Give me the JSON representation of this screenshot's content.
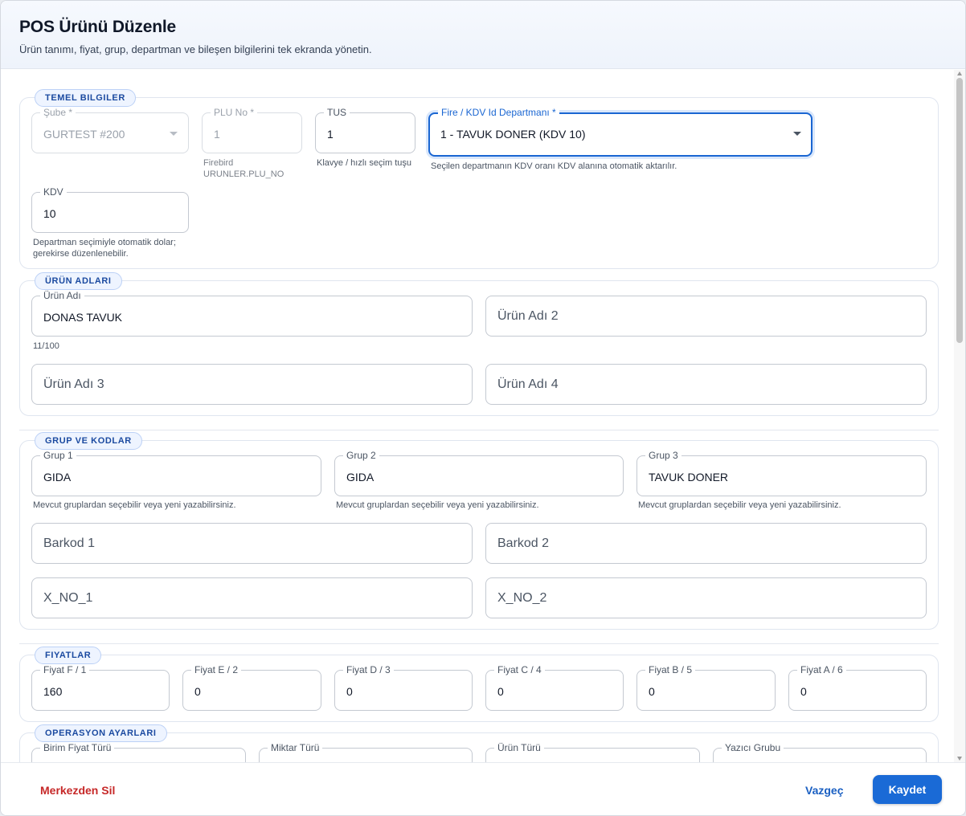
{
  "header": {
    "title": "POS Ürünü Düzenle",
    "subtitle": "Ürün tanımı, fiyat, grup, departman ve bileşen bilgilerini tek ekranda yönetin."
  },
  "sections": {
    "temel": {
      "label": "TEMEL BILGILER",
      "sube": {
        "label": "Şube *",
        "value": "GURTEST #200"
      },
      "plu": {
        "label": "PLU No *",
        "value": "1",
        "help": "Firebird URUNLER.PLU_NO"
      },
      "tus": {
        "label": "TUS",
        "value": "1",
        "help": "Klavye / hızlı seçim tuşu"
      },
      "departman": {
        "label": "Fire / KDV Id Departmanı *",
        "value": "1 - TAVUK DONER (KDV 10)",
        "help": "Seçilen departmanın KDV oranı KDV alanına otomatik aktarılır."
      },
      "kdv": {
        "label": "KDV",
        "value": "10",
        "help": "Departman seçimiyle otomatik dolar; gerekirse düzenlenebilir."
      }
    },
    "adlar": {
      "label": "ÜRÜN ADLARI",
      "urun_adi": {
        "label": "Ürün Adı",
        "value": "DONAS TAVUK",
        "counter": "11/100"
      },
      "urun_adi_2": {
        "placeholder": "Ürün Adı 2"
      },
      "urun_adi_3": {
        "placeholder": "Ürün Adı 3"
      },
      "urun_adi_4": {
        "placeholder": "Ürün Adı 4"
      }
    },
    "grup": {
      "label": "GRUP VE KODLAR",
      "grup1": {
        "label": "Grup 1",
        "value": "GIDA",
        "help": "Mevcut gruplardan seçebilir veya yeni yazabilirsiniz."
      },
      "grup2": {
        "label": "Grup 2",
        "value": "GIDA",
        "help": "Mevcut gruplardan seçebilir veya yeni yazabilirsiniz."
      },
      "grup3": {
        "label": "Grup 3",
        "value": "TAVUK DONER",
        "help": "Mevcut gruplardan seçebilir veya yeni yazabilirsiniz."
      },
      "barkod1": {
        "placeholder": "Barkod 1"
      },
      "barkod2": {
        "placeholder": "Barkod 2"
      },
      "xno1": {
        "placeholder": "X_NO_1"
      },
      "xno2": {
        "placeholder": "X_NO_2"
      }
    },
    "fiyatlar": {
      "label": "FIYATLAR",
      "items": [
        {
          "label": "Fiyat F / 1",
          "value": "160"
        },
        {
          "label": "Fiyat E / 2",
          "value": "0"
        },
        {
          "label": "Fiyat D / 3",
          "value": "0"
        },
        {
          "label": "Fiyat C / 4",
          "value": "0"
        },
        {
          "label": "Fiyat B / 5",
          "value": "0"
        },
        {
          "label": "Fiyat A / 6",
          "value": "0"
        }
      ]
    },
    "operasyon": {
      "label": "OPERASYON AYARLARI",
      "birim_fiyat_turu": {
        "label": "Birim Fiyat Türü"
      },
      "miktar_turu": {
        "label": "Miktar Türü"
      },
      "urun_turu": {
        "label": "Ürün Türü"
      },
      "yazici_grubu": {
        "label": "Yazıcı Grubu"
      }
    }
  },
  "footer": {
    "delete_label": "Merkezden Sil",
    "cancel_label": "Vazgeç",
    "save_label": "Kaydet"
  },
  "colors": {
    "primary": "#1a6ad6",
    "danger": "#c62828",
    "section_label_bg": "#eef4ff"
  }
}
